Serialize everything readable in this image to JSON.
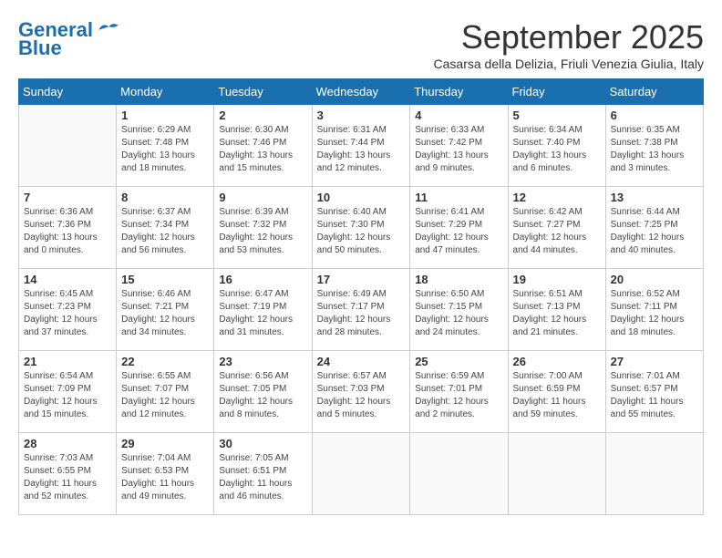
{
  "header": {
    "logo": {
      "general": "General",
      "blue": "Blue"
    },
    "title": "September 2025",
    "subtitle": "Casarsa della Delizia, Friuli Venezia Giulia, Italy"
  },
  "columns": [
    "Sunday",
    "Monday",
    "Tuesday",
    "Wednesday",
    "Thursday",
    "Friday",
    "Saturday"
  ],
  "weeks": [
    [
      {
        "day": "",
        "info": ""
      },
      {
        "day": "1",
        "info": "Sunrise: 6:29 AM\nSunset: 7:48 PM\nDaylight: 13 hours\nand 18 minutes."
      },
      {
        "day": "2",
        "info": "Sunrise: 6:30 AM\nSunset: 7:46 PM\nDaylight: 13 hours\nand 15 minutes."
      },
      {
        "day": "3",
        "info": "Sunrise: 6:31 AM\nSunset: 7:44 PM\nDaylight: 13 hours\nand 12 minutes."
      },
      {
        "day": "4",
        "info": "Sunrise: 6:33 AM\nSunset: 7:42 PM\nDaylight: 13 hours\nand 9 minutes."
      },
      {
        "day": "5",
        "info": "Sunrise: 6:34 AM\nSunset: 7:40 PM\nDaylight: 13 hours\nand 6 minutes."
      },
      {
        "day": "6",
        "info": "Sunrise: 6:35 AM\nSunset: 7:38 PM\nDaylight: 13 hours\nand 3 minutes."
      }
    ],
    [
      {
        "day": "7",
        "info": "Sunrise: 6:36 AM\nSunset: 7:36 PM\nDaylight: 13 hours\nand 0 minutes."
      },
      {
        "day": "8",
        "info": "Sunrise: 6:37 AM\nSunset: 7:34 PM\nDaylight: 12 hours\nand 56 minutes."
      },
      {
        "day": "9",
        "info": "Sunrise: 6:39 AM\nSunset: 7:32 PM\nDaylight: 12 hours\nand 53 minutes."
      },
      {
        "day": "10",
        "info": "Sunrise: 6:40 AM\nSunset: 7:30 PM\nDaylight: 12 hours\nand 50 minutes."
      },
      {
        "day": "11",
        "info": "Sunrise: 6:41 AM\nSunset: 7:29 PM\nDaylight: 12 hours\nand 47 minutes."
      },
      {
        "day": "12",
        "info": "Sunrise: 6:42 AM\nSunset: 7:27 PM\nDaylight: 12 hours\nand 44 minutes."
      },
      {
        "day": "13",
        "info": "Sunrise: 6:44 AM\nSunset: 7:25 PM\nDaylight: 12 hours\nand 40 minutes."
      }
    ],
    [
      {
        "day": "14",
        "info": "Sunrise: 6:45 AM\nSunset: 7:23 PM\nDaylight: 12 hours\nand 37 minutes."
      },
      {
        "day": "15",
        "info": "Sunrise: 6:46 AM\nSunset: 7:21 PM\nDaylight: 12 hours\nand 34 minutes."
      },
      {
        "day": "16",
        "info": "Sunrise: 6:47 AM\nSunset: 7:19 PM\nDaylight: 12 hours\nand 31 minutes."
      },
      {
        "day": "17",
        "info": "Sunrise: 6:49 AM\nSunset: 7:17 PM\nDaylight: 12 hours\nand 28 minutes."
      },
      {
        "day": "18",
        "info": "Sunrise: 6:50 AM\nSunset: 7:15 PM\nDaylight: 12 hours\nand 24 minutes."
      },
      {
        "day": "19",
        "info": "Sunrise: 6:51 AM\nSunset: 7:13 PM\nDaylight: 12 hours\nand 21 minutes."
      },
      {
        "day": "20",
        "info": "Sunrise: 6:52 AM\nSunset: 7:11 PM\nDaylight: 12 hours\nand 18 minutes."
      }
    ],
    [
      {
        "day": "21",
        "info": "Sunrise: 6:54 AM\nSunset: 7:09 PM\nDaylight: 12 hours\nand 15 minutes."
      },
      {
        "day": "22",
        "info": "Sunrise: 6:55 AM\nSunset: 7:07 PM\nDaylight: 12 hours\nand 12 minutes."
      },
      {
        "day": "23",
        "info": "Sunrise: 6:56 AM\nSunset: 7:05 PM\nDaylight: 12 hours\nand 8 minutes."
      },
      {
        "day": "24",
        "info": "Sunrise: 6:57 AM\nSunset: 7:03 PM\nDaylight: 12 hours\nand 5 minutes."
      },
      {
        "day": "25",
        "info": "Sunrise: 6:59 AM\nSunset: 7:01 PM\nDaylight: 12 hours\nand 2 minutes."
      },
      {
        "day": "26",
        "info": "Sunrise: 7:00 AM\nSunset: 6:59 PM\nDaylight: 11 hours\nand 59 minutes."
      },
      {
        "day": "27",
        "info": "Sunrise: 7:01 AM\nSunset: 6:57 PM\nDaylight: 11 hours\nand 55 minutes."
      }
    ],
    [
      {
        "day": "28",
        "info": "Sunrise: 7:03 AM\nSunset: 6:55 PM\nDaylight: 11 hours\nand 52 minutes."
      },
      {
        "day": "29",
        "info": "Sunrise: 7:04 AM\nSunset: 6:53 PM\nDaylight: 11 hours\nand 49 minutes."
      },
      {
        "day": "30",
        "info": "Sunrise: 7:05 AM\nSunset: 6:51 PM\nDaylight: 11 hours\nand 46 minutes."
      },
      {
        "day": "",
        "info": ""
      },
      {
        "day": "",
        "info": ""
      },
      {
        "day": "",
        "info": ""
      },
      {
        "day": "",
        "info": ""
      }
    ]
  ]
}
